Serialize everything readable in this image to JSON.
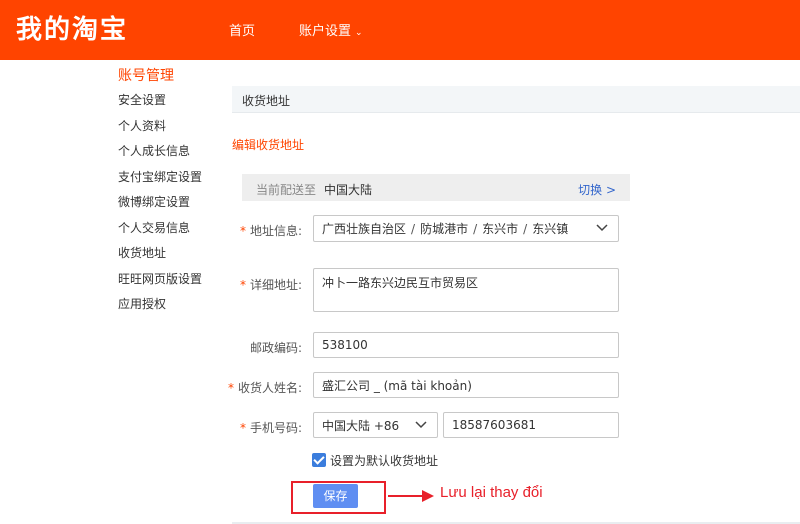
{
  "header": {
    "logo": "我的淘宝",
    "nav": {
      "home": "首页",
      "account_settings": "账户设置",
      "caret": "⌄"
    },
    "bg_color": "#ff4400"
  },
  "sidebar": {
    "title": "账号管理",
    "items": [
      {
        "label": "安全设置"
      },
      {
        "label": "个人资料"
      },
      {
        "label": "个人成长信息"
      },
      {
        "label": "支付宝绑定设置"
      },
      {
        "label": "微博绑定设置"
      },
      {
        "label": "个人交易信息"
      },
      {
        "label": "收货地址"
      },
      {
        "label": "旺旺网页版设置"
      },
      {
        "label": "应用授权"
      }
    ]
  },
  "panel": {
    "header": "收货地址",
    "section_title": "编辑收货地址"
  },
  "region": {
    "label": "当前配送至",
    "value": "中国大陆",
    "switch": "切换 >"
  },
  "form": {
    "address": {
      "label": "详细地址:",
      "region_label": "地址信息:",
      "province": "广西壮族自治区",
      "city": "防城港市",
      "district": "东兴市",
      "town": "东兴镇",
      "separator": "/",
      "detail": "冲卜一路东兴边民互市贸易区"
    },
    "postcode": {
      "label": "邮政编码:",
      "value": "538100"
    },
    "recipient": {
      "label": "收货人姓名:",
      "value": "盛汇公司 _ (mã tài khoản)"
    },
    "phone": {
      "label": "手机号码:",
      "country": "中国大陆 +86",
      "number": "18587603681"
    },
    "default_checkbox": {
      "label": "设置为默认收货地址",
      "checked": true
    },
    "save_label": "保存",
    "required_mark": "*"
  },
  "annotation": {
    "text": "Lưu lại thay đổi",
    "color": "#e8202a"
  },
  "icons": {
    "dropdown": "chevron-down-icon",
    "check": "check-icon",
    "arrow": "arrow-right-icon"
  }
}
